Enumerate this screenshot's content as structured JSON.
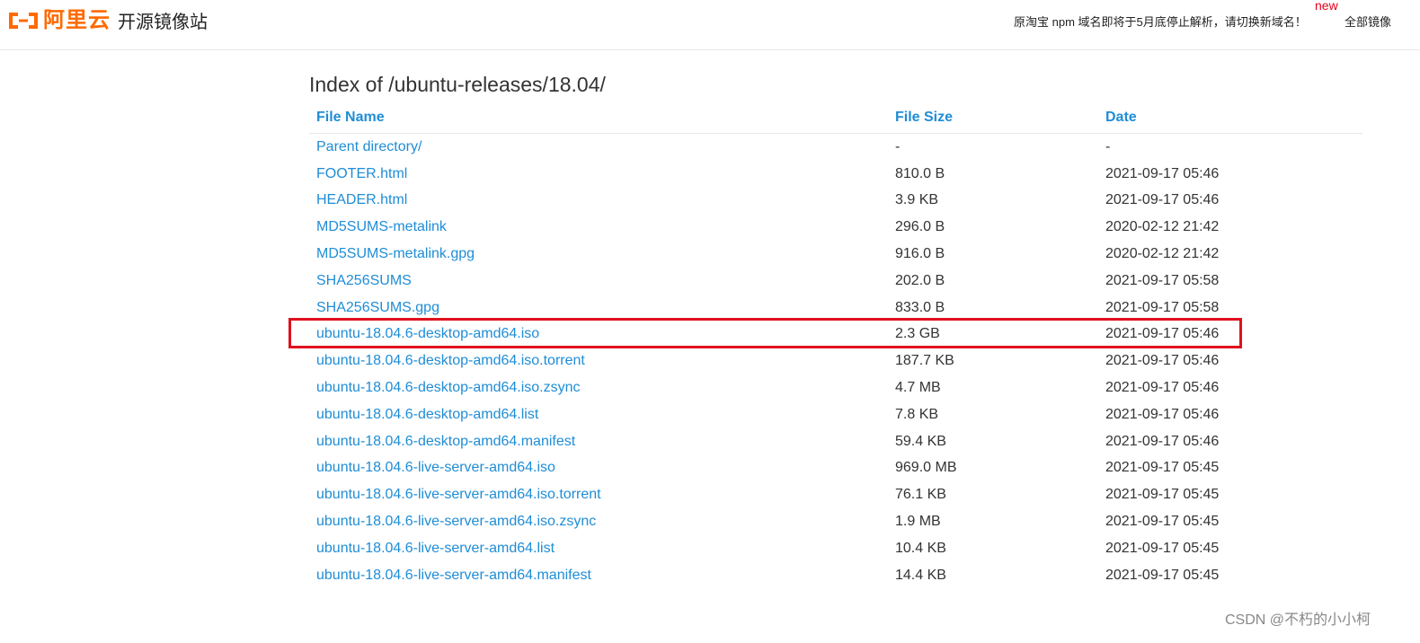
{
  "header": {
    "logo_text": "阿里云",
    "site_title": "开源镜像站",
    "notice": "原淘宝 npm 域名即将于5月底停止解析，请切换新域名！",
    "new_badge": "new",
    "all_mirrors": "全部镜像",
    "brand_color": "#ff6a00"
  },
  "main": {
    "heading": "Index of /ubuntu-releases/18.04/",
    "columns": {
      "name": "File Name",
      "size": "File Size",
      "date": "Date"
    },
    "rows": [
      {
        "name": "Parent directory/",
        "size": "-",
        "date": "-"
      },
      {
        "name": "FOOTER.html",
        "size": "810.0 B",
        "date": "2021-09-17 05:46"
      },
      {
        "name": "HEADER.html",
        "size": "3.9 KB",
        "date": "2021-09-17 05:46"
      },
      {
        "name": "MD5SUMS-metalink",
        "size": "296.0 B",
        "date": "2020-02-12 21:42"
      },
      {
        "name": "MD5SUMS-metalink.gpg",
        "size": "916.0 B",
        "date": "2020-02-12 21:42"
      },
      {
        "name": "SHA256SUMS",
        "size": "202.0 B",
        "date": "2021-09-17 05:58"
      },
      {
        "name": "SHA256SUMS.gpg",
        "size": "833.0 B",
        "date": "2021-09-17 05:58"
      },
      {
        "name": "ubuntu-18.04.6-desktop-amd64.iso",
        "size": "2.3 GB",
        "date": "2021-09-17 05:46"
      },
      {
        "name": "ubuntu-18.04.6-desktop-amd64.iso.torrent",
        "size": "187.7 KB",
        "date": "2021-09-17 05:46"
      },
      {
        "name": "ubuntu-18.04.6-desktop-amd64.iso.zsync",
        "size": "4.7 MB",
        "date": "2021-09-17 05:46"
      },
      {
        "name": "ubuntu-18.04.6-desktop-amd64.list",
        "size": "7.8 KB",
        "date": "2021-09-17 05:46"
      },
      {
        "name": "ubuntu-18.04.6-desktop-amd64.manifest",
        "size": "59.4 KB",
        "date": "2021-09-17 05:46"
      },
      {
        "name": "ubuntu-18.04.6-live-server-amd64.iso",
        "size": "969.0 MB",
        "date": "2021-09-17 05:45"
      },
      {
        "name": "ubuntu-18.04.6-live-server-amd64.iso.torrent",
        "size": "76.1 KB",
        "date": "2021-09-17 05:45"
      },
      {
        "name": "ubuntu-18.04.6-live-server-amd64.iso.zsync",
        "size": "1.9 MB",
        "date": "2021-09-17 05:45"
      },
      {
        "name": "ubuntu-18.04.6-live-server-amd64.list",
        "size": "10.4 KB",
        "date": "2021-09-17 05:45"
      },
      {
        "name": "ubuntu-18.04.6-live-server-amd64.manifest",
        "size": "14.4 KB",
        "date": "2021-09-17 05:45"
      }
    ],
    "link_color": "#1f8dd6",
    "highlight_color": "#e0101e"
  },
  "watermark": "CSDN @不朽的小小柯"
}
